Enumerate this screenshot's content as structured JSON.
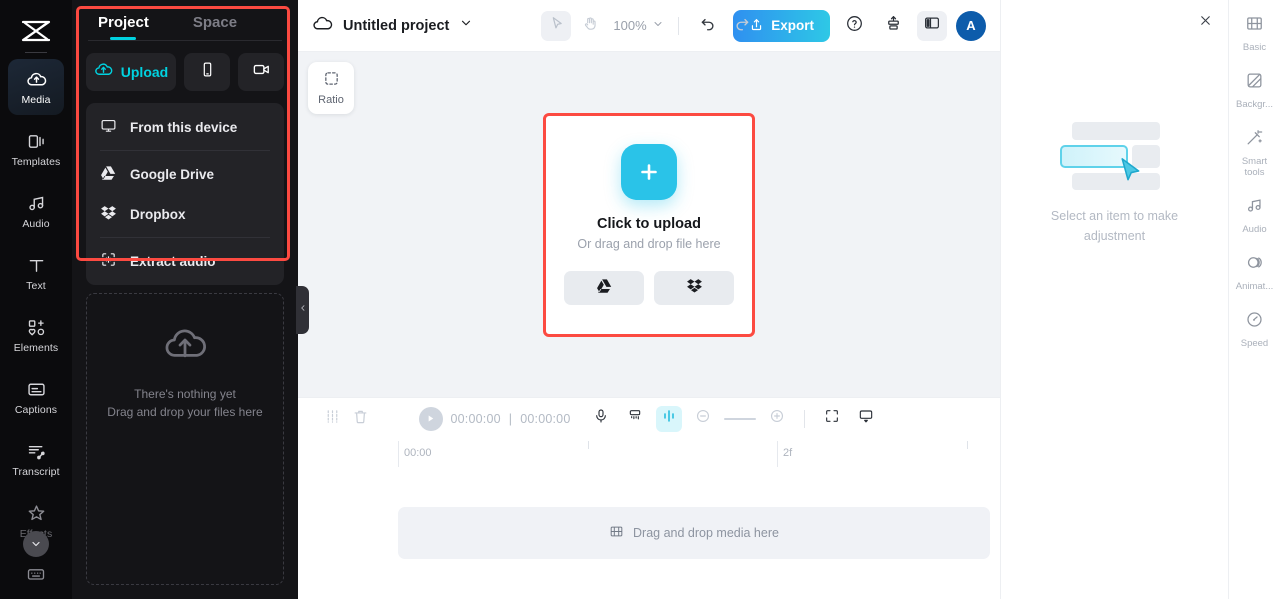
{
  "rail": {
    "logo": "capcut-logo",
    "items": [
      {
        "label": "Media",
        "icon": "cloud-upload-icon",
        "active": true
      },
      {
        "label": "Templates",
        "icon": "templates-icon",
        "active": false
      },
      {
        "label": "Audio",
        "icon": "music-note-icon",
        "active": false
      },
      {
        "label": "Text",
        "icon": "text-t-icon",
        "active": false
      },
      {
        "label": "Elements",
        "icon": "elements-icon",
        "active": false
      },
      {
        "label": "Captions",
        "icon": "captions-icon",
        "active": false
      },
      {
        "label": "Transcript",
        "icon": "transcript-icon",
        "active": false
      },
      {
        "label": "Effects",
        "icon": "sparkle-star-icon",
        "active": false
      }
    ],
    "expand_more": "chevron-down-icon",
    "bottom_icon": "keyboard-icon"
  },
  "media_panel": {
    "tabs": [
      {
        "label": "Project",
        "active": true
      },
      {
        "label": "Space",
        "active": false
      }
    ],
    "upload_label": "Upload",
    "upload_icon": "cloud-upload-icon",
    "phone_icon": "phone-icon",
    "camera_icon": "video-camera-icon",
    "menu": [
      {
        "label": "From this device",
        "icon": "monitor-icon"
      },
      {
        "label": "Google Drive",
        "icon": "google-drive-icon"
      },
      {
        "label": "Dropbox",
        "icon": "dropbox-icon"
      },
      {
        "label": "Extract audio",
        "icon": "extract-audio-icon"
      }
    ],
    "empty_icon": "cloud-upload-icon",
    "empty_line1": "There's nothing yet",
    "empty_line2": "Drag and drop your files here",
    "collapse_icon": "chevron-left-icon"
  },
  "topbar": {
    "cloud_icon": "cloud-icon",
    "project_title": "Untitled project",
    "title_chevron": "chevron-down-icon",
    "select_tool_icon": "cursor-arrow-icon",
    "hand_tool_icon": "hand-icon",
    "zoom_level": "100%",
    "zoom_chevron": "chevron-down-icon",
    "undo_icon": "undo-icon",
    "redo_icon": "redo-icon",
    "export_label": "Export",
    "export_icon": "share-up-icon",
    "help_icon": "question-circle-icon",
    "layout_icon": "stack-icon",
    "panel_toggle_icon": "split-panel-icon",
    "avatar_initial": "A"
  },
  "stage": {
    "ratio_label": "Ratio",
    "ratio_icon": "dashed-square-icon",
    "upload_card": {
      "plus_icon": "plus-icon",
      "title": "Click to upload",
      "subtitle": "Or drag and drop file here",
      "buttons": [
        {
          "icon": "google-drive-icon",
          "name": "google-drive"
        },
        {
          "icon": "dropbox-icon",
          "name": "dropbox"
        }
      ]
    }
  },
  "timeline": {
    "toolbar": {
      "split_icon": "split-clip-icon",
      "delete_icon": "trash-icon",
      "play_icon": "play-icon",
      "current_time": "00:00:00",
      "time_separator": "|",
      "total_time": "00:00:00",
      "mic_icon": "microphone-icon",
      "mixer_icon": "audio-mixer-icon",
      "waveform_icon": "waveform-icon",
      "zoom_out_icon": "minus-circle-icon",
      "zoom_in_icon": "plus-circle-icon",
      "fit_icon": "fit-screen-icon",
      "monitor_icon": "preview-monitor-icon"
    },
    "ruler_labels": [
      "00:00",
      "2f"
    ],
    "drop_icon": "film-strip-icon",
    "drop_label": "Drag and drop media here"
  },
  "right_panel": {
    "close_icon": "close-icon",
    "empty_text": "Select an item to make adjustment",
    "cursor_icon": "cursor-arrow-icon"
  },
  "right_rail": {
    "items": [
      {
        "label": "Basic",
        "icon": "film-strip-icon"
      },
      {
        "label": "Backgr...",
        "icon": "background-icon"
      },
      {
        "label": "Smart tools",
        "icon": "magic-wand-icon"
      },
      {
        "label": "Audio",
        "icon": "music-note-icon"
      },
      {
        "label": "Animat...",
        "icon": "animation-icon"
      },
      {
        "label": "Speed",
        "icon": "speedometer-icon"
      }
    ]
  },
  "colors": {
    "accent_cyan": "#00d2e0",
    "highlight_red": "#fc4a41",
    "plus_blue": "#2ac3e8",
    "avatar_blue": "#0d5cab"
  }
}
